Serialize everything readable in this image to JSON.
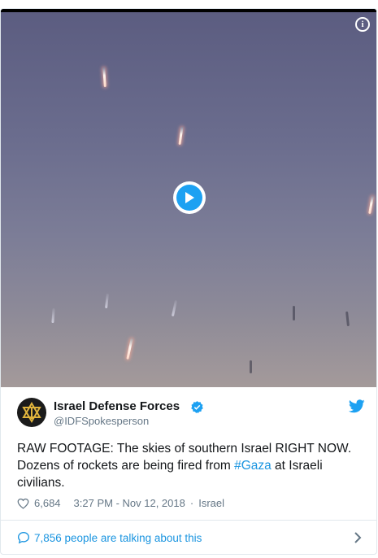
{
  "video": {
    "play_icon": "play-icon",
    "info_icon": "info-icon",
    "info_glyph": "i"
  },
  "tweet": {
    "display_name": "Israel Defense Forces",
    "handle": "@IDFSpokesperson",
    "text_before_hashtag": "RAW FOOTAGE: The skies of southern Israel RIGHT NOW. Dozens of rockets are being fired from ",
    "hashtag": "#Gaza",
    "text_after_hashtag": " at Israeli civilians.",
    "likes": "6,684",
    "timestamp": "3:27 PM - Nov 12, 2018",
    "separator": "·",
    "location": "Israel",
    "talking": "7,856 people are talking about this"
  },
  "colors": {
    "accent": "#1da1f2",
    "link": "#1b95e0",
    "muted": "#657786"
  }
}
